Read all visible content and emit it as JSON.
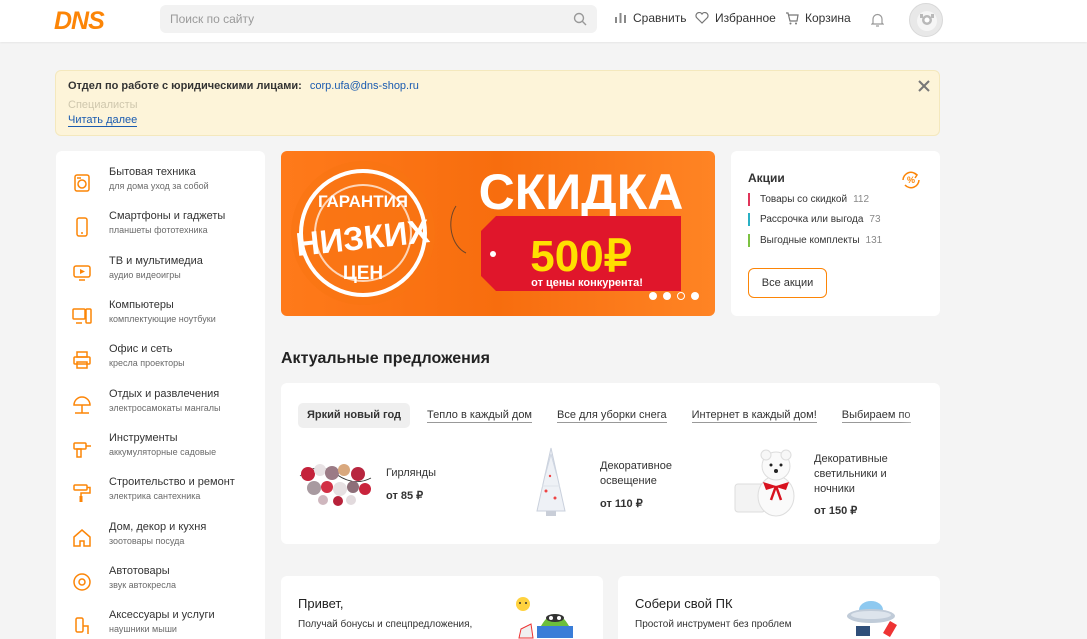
{
  "header": {
    "logo": "DNS",
    "search_placeholder": "Поиск по сайту",
    "compare_label": "Сравнить",
    "favorites_label": "Избранное",
    "cart_label": "Корзина"
  },
  "notice": {
    "label": "Отдел по работе с юридическими лицами:",
    "email": "corp.ufa@dns-shop.ru",
    "second_line": "Специалисты",
    "read_more": "Читать далее"
  },
  "sidebar": {
    "items": [
      {
        "label": "Бытовая техника",
        "sub": "для дома  уход за собой",
        "icon": "appliance-icon"
      },
      {
        "label": "Смартфоны и гаджеты",
        "sub": "планшеты  фототехника",
        "icon": "smartphone-icon"
      },
      {
        "label": "ТВ и мультимедиа",
        "sub": "аудио  видеоигры",
        "icon": "tv-icon"
      },
      {
        "label": "Компьютеры",
        "sub": "комплектующие  ноутбуки",
        "icon": "computer-icon"
      },
      {
        "label": "Офис и сеть",
        "sub": "кресла  проекторы",
        "icon": "printer-icon"
      },
      {
        "label": "Отдых и развлечения",
        "sub": "электросамокаты  мангалы",
        "icon": "umbrella-icon"
      },
      {
        "label": "Инструменты",
        "sub": "аккумуляторные  садовые",
        "icon": "drill-icon"
      },
      {
        "label": "Строительство и ремонт",
        "sub": "электрика  сантехника",
        "icon": "paint-roller-icon"
      },
      {
        "label": "Дом, декор и кухня",
        "sub": "зоотовары  посуда",
        "icon": "house-icon"
      },
      {
        "label": "Автотовары",
        "sub": "звук  автокресла",
        "icon": "wheel-icon"
      },
      {
        "label": "Аксессуары и услуги",
        "sub": "наушники  мыши",
        "icon": "accessories-icon"
      }
    ]
  },
  "banner": {
    "stamp_top": "ГАРАНТИЯ",
    "stamp_mid": "НИЗКИХ",
    "stamp_bottom": "ЦЕН",
    "headline": "СКИДКА",
    "amount": "500₽",
    "tag_text": "от цены конкурента!",
    "slides_total": 4,
    "slide_active": 3
  },
  "promo": {
    "title": "Акции",
    "items": [
      {
        "label": "Товары со скидкой",
        "count": "112",
        "color": "#e0355a"
      },
      {
        "label": "Рассрочка или выгода",
        "count": "73",
        "color": "#2ab0c4"
      },
      {
        "label": "Выгодные комплекты",
        "count": "131",
        "color": "#7cc242"
      }
    ],
    "button": "Все акции"
  },
  "offers": {
    "title": "Актуальные предложения",
    "tabs": [
      "Яркий новый год",
      "Тепло в каждый дом",
      "Все для уборки снега",
      "Интернет в каждый дом!",
      "Выбираем по"
    ],
    "products": [
      {
        "name_line1": "Гирлянды",
        "name_line2": "",
        "name_line3": "",
        "price": "от 85 ₽"
      },
      {
        "name_line1": "Декоративное",
        "name_line2": "освещение",
        "name_line3": "",
        "price": "от 110 ₽"
      },
      {
        "name_line1": "Декоративные",
        "name_line2": "светильники и",
        "name_line3": "ночники",
        "price": "от 150 ₽"
      }
    ]
  },
  "cards": [
    {
      "title": "Привет,",
      "text": "Получай бонусы и спецпредложения,"
    },
    {
      "title": "Собери свой ПК",
      "text": "Простой инструмент без проблем"
    }
  ],
  "colors": {
    "accent": "#fc8507",
    "link": "#1a5bb0",
    "notice_bg": "#fdf4d9",
    "page_bg": "#f4f4f4"
  }
}
